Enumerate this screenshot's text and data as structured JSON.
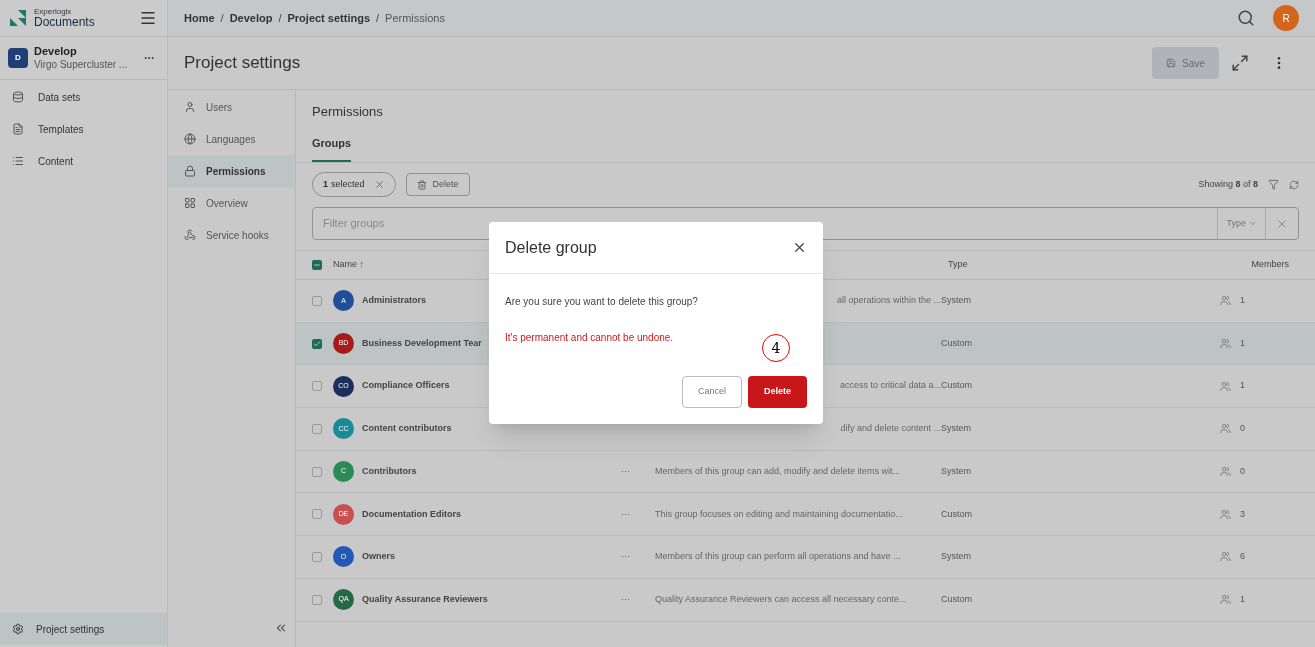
{
  "logo": {
    "top": "Experlogix",
    "bottom": "Documents"
  },
  "project": {
    "initial": "D",
    "name": "Develop",
    "subtitle": "Virgo Supercluster ..."
  },
  "sidebar": {
    "items": [
      {
        "label": "Data sets",
        "selected": false
      },
      {
        "label": "Templates",
        "selected": false
      },
      {
        "label": "Content",
        "selected": false
      }
    ],
    "footer": {
      "label": "Project settings",
      "selected": true
    }
  },
  "breadcrumb": {
    "separator": "/",
    "items": [
      "Home",
      "Develop",
      "Project settings",
      "Permissions"
    ]
  },
  "user": {
    "initial": "R"
  },
  "page_title": "Project settings",
  "save_button": {
    "label": "Save",
    "disabled": true
  },
  "settings_nav": [
    {
      "label": "Users",
      "selected": false
    },
    {
      "label": "Languages",
      "selected": false
    },
    {
      "label": "Permissions",
      "selected": true
    },
    {
      "label": "Overview",
      "selected": false
    },
    {
      "label": "Service hooks",
      "selected": false
    }
  ],
  "section_title": "Permissions",
  "tabs": [
    {
      "label": "Groups",
      "selected": true
    }
  ],
  "selection_chip": {
    "count": "1",
    "text": "selected"
  },
  "delete_button": "Delete",
  "showing": {
    "prefix": "Showing",
    "shown": "8",
    "of": "of",
    "total": "8"
  },
  "filter": {
    "placeholder": "Filter groups",
    "type_label": "Type"
  },
  "table": {
    "select_all_indeterminate": true,
    "columns": {
      "name": "Name ↑",
      "type": "Type",
      "members": "Members"
    },
    "rows": [
      {
        "initials": "A",
        "color": "#1f4f99",
        "name": "Administrators",
        "description": "all operations within the ...",
        "type": "System",
        "members": "1",
        "checked": false
      },
      {
        "initials": "BD",
        "color": "#a81b1b",
        "name": "Business Development Tear",
        "type": "Custom",
        "members": "1",
        "checked": true
      },
      {
        "initials": "CO",
        "color": "#1b2f5a",
        "name": "Compliance Officers",
        "description": "access to critical data a...",
        "type": "Custom",
        "members": "1",
        "checked": false
      },
      {
        "initials": "CC",
        "color": "#1a8a96",
        "name": "Content contributors",
        "description": "dify and delete content ...",
        "type": "System",
        "members": "0",
        "checked": false
      },
      {
        "initials": "C",
        "color": "#2e8a55",
        "name": "Contributors",
        "menu": "···",
        "description": "Members of this group can add, modify and delete items wit...",
        "type": "System",
        "members": "0",
        "checked": false
      },
      {
        "initials": "DE",
        "color": "#c85050",
        "name": "Documentation Editors",
        "menu": "···",
        "description": "This group focuses on editing and maintaining documentatio...",
        "type": "Custom",
        "members": "3",
        "checked": false
      },
      {
        "initials": "O",
        "color": "#2458b5",
        "name": "Owners",
        "menu": "···",
        "description": "Members of this group can perform all operations and have ...",
        "type": "System",
        "members": "6",
        "checked": false
      },
      {
        "initials": "QA",
        "color": "#246b45",
        "name": "Quality Assurance Reviewers",
        "menu": "···",
        "description": "Quality Assurance Reviewers can access all necessary conte...",
        "type": "Custom",
        "members": "1",
        "checked": false
      }
    ]
  },
  "dialog": {
    "title": "Delete group",
    "message": "Are you sure you want to delete this group?",
    "warning": "It's permanent and cannot be undone.",
    "annotation": "4",
    "cancel": "Cancel",
    "confirm": "Delete"
  }
}
